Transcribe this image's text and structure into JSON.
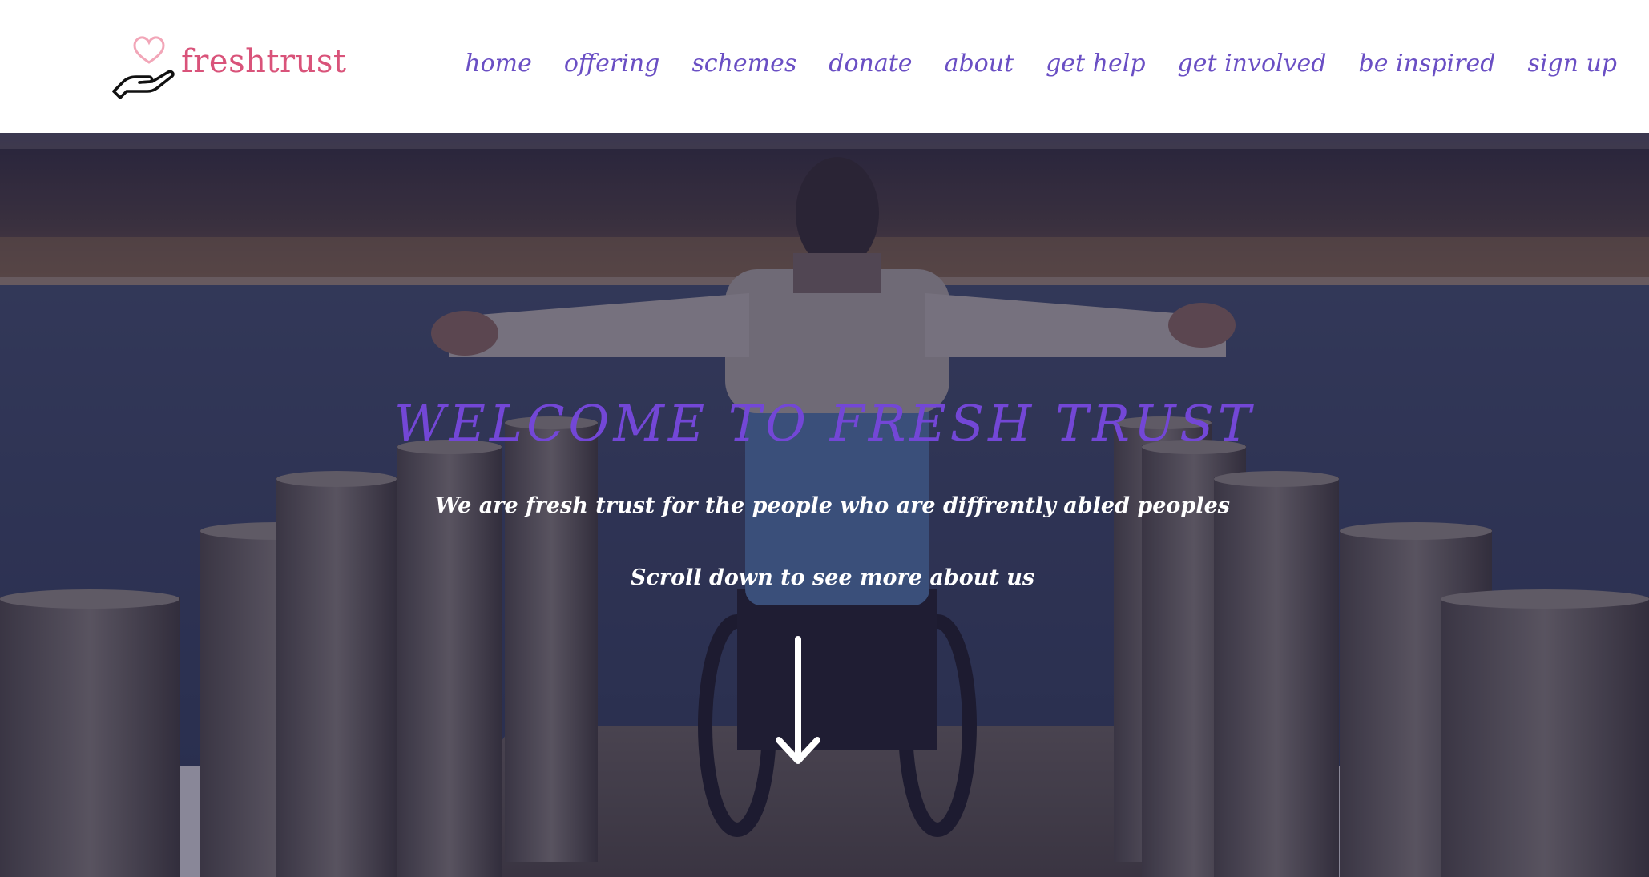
{
  "brand": {
    "name": "freshtrust",
    "heart_color": "#f2a6b8",
    "text_color": "#d9537a"
  },
  "nav": {
    "items": [
      {
        "label": "home"
      },
      {
        "label": "offering"
      },
      {
        "label": "schemes"
      },
      {
        "label": "donate"
      },
      {
        "label": "about"
      },
      {
        "label": "get help"
      },
      {
        "label": "get involved"
      },
      {
        "label": "be inspired"
      },
      {
        "label": "sign up"
      }
    ],
    "color": "#6a4fc4"
  },
  "hero": {
    "title": "WELCOME TO FRESH TRUST",
    "subtitle": "We are fresh trust for the people who are diffrently abled peoples",
    "scroll_text": "Scroll down to see more about us",
    "title_color": "#7347d6",
    "arrow_icon": "arrow-down-icon"
  }
}
